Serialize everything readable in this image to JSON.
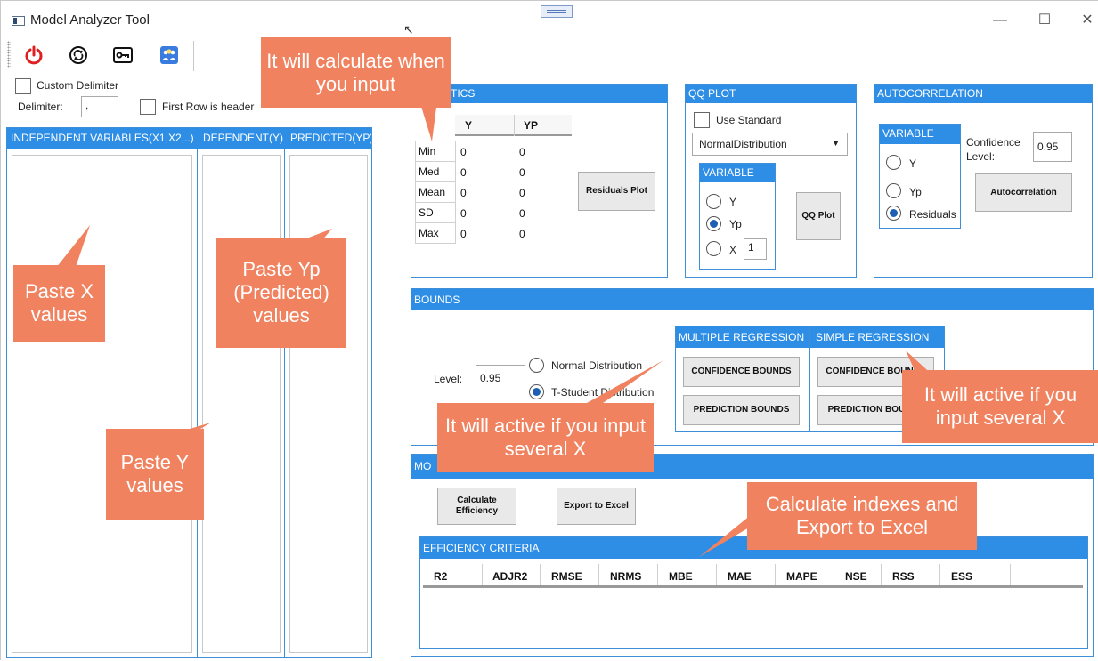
{
  "window": {
    "title": "Model Analyzer Tool"
  },
  "toolbar": {
    "icons": [
      "power-icon",
      "refresh-icon",
      "key-icon",
      "team-icon"
    ]
  },
  "options": {
    "custom_delimiter": "Custom Delimiter",
    "delimiter_label": "Delimiter:",
    "delimiter_value": ",",
    "first_row_header": "First Row is header"
  },
  "data_columns": {
    "independent": "INDEPENDENT VARIABLES(X1,X2,..)",
    "dependent": "DEPENDENT(Y)",
    "predicted": "PREDICTED(YP)"
  },
  "statistics": {
    "title_partial": "TICS",
    "col_y": "Y",
    "col_yp": "YP",
    "rows": [
      {
        "label": "Min",
        "y": "0",
        "yp": "0"
      },
      {
        "label": "Med",
        "y": "0",
        "yp": "0"
      },
      {
        "label": "Mean",
        "y": "0",
        "yp": "0"
      },
      {
        "label": "SD",
        "y": "0",
        "yp": "0"
      },
      {
        "label": "Max",
        "y": "0",
        "yp": "0"
      }
    ],
    "residuals_button": "Residuals Plot"
  },
  "qq_plot": {
    "title": "QQ PLOT",
    "use_standard": "Use Standard",
    "distribution": "NormalDistribution",
    "variable_title": "VARIABLE",
    "opt_y": "Y",
    "opt_yp": "Yp",
    "opt_x": "X",
    "x_value": "1",
    "button": "QQ Plot"
  },
  "autocorrelation": {
    "title": "AUTOCORRELATION",
    "variable_title": "VARIABLE",
    "opt_y": "Y",
    "opt_yp": "Yp",
    "opt_residuals": "Residuals",
    "confidence_label": "Confidence Level:",
    "confidence_value": "0.95",
    "button": "Autocorrelation"
  },
  "bounds": {
    "title": "BOUNDS",
    "level_label": "Level:",
    "level_value": "0.95",
    "normal": "Normal Distribution",
    "tstudent": "T-Student Distribution",
    "multiple_title": "MULTIPLE REGRESSION",
    "simple_title": "SIMPLE REGRESSION",
    "confidence_bounds": "CONFIDENCE BOUNDS",
    "prediction_bounds": "PREDICTION BOUNDS"
  },
  "model": {
    "title_partial": "MO",
    "calc_button": "Calculate Efficiency",
    "export_button": "Export to Excel",
    "criteria_title": "EFFICIENCY CRITERIA",
    "columns": [
      "R2",
      "ADJR2",
      "RMSE",
      "NRMS",
      "MBE",
      "MAE",
      "MAPE",
      "NSE",
      "RSS",
      "ESS"
    ]
  },
  "callouts": {
    "calc_input": "It will calculate when you input",
    "paste_x": "Paste X values",
    "paste_yp": "Paste Yp (Predicted) values",
    "paste_y": "Paste Y values",
    "active_several_x_1": "It will active if you input several X",
    "active_several_x_2": "It will active if you input several X",
    "calc_indexes": "Calculate indexes and Export to Excel"
  },
  "colors": {
    "accent": "#2e8ee6",
    "callout": "#f0825f",
    "power": "#e02020"
  }
}
